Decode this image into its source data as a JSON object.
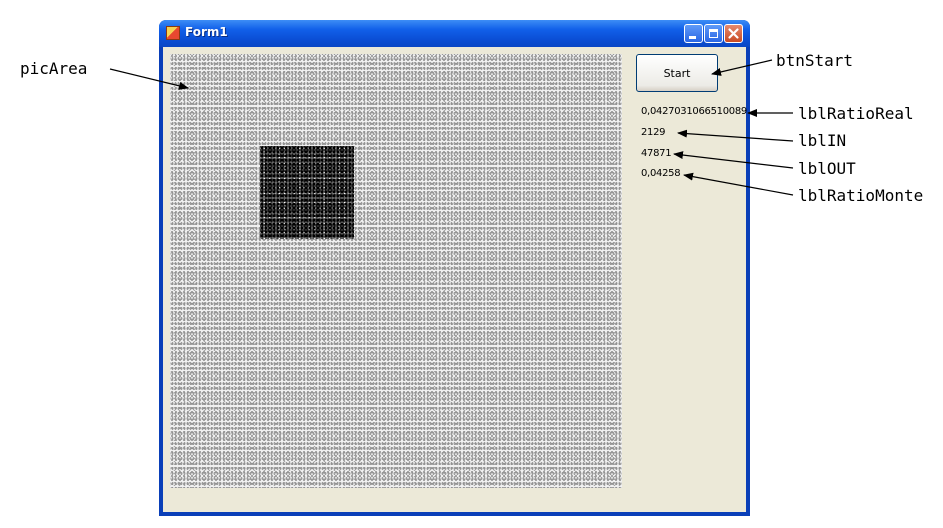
{
  "window": {
    "title": "Form1"
  },
  "title_buttons": [
    "minimize-icon",
    "maximize-icon",
    "close-icon"
  ],
  "controls": {
    "start_label": "Start",
    "ratio_real": "0,0427031066510089",
    "in_count": "2129",
    "out_count": "47871",
    "ratio_monte": "0,04258"
  },
  "annotations": {
    "pic_area": "picArea",
    "btn_start": "btnStart",
    "lbl_ratio_real": "lblRatioReal",
    "lbl_in": "lblIN",
    "lbl_out": "lblOUT",
    "lbl_ratio_monte": "lblRatioMonte"
  },
  "colors": {
    "titlebar": "#0b4fd6",
    "client_bg": "#ece9d8",
    "close_button": "#c94a23"
  }
}
